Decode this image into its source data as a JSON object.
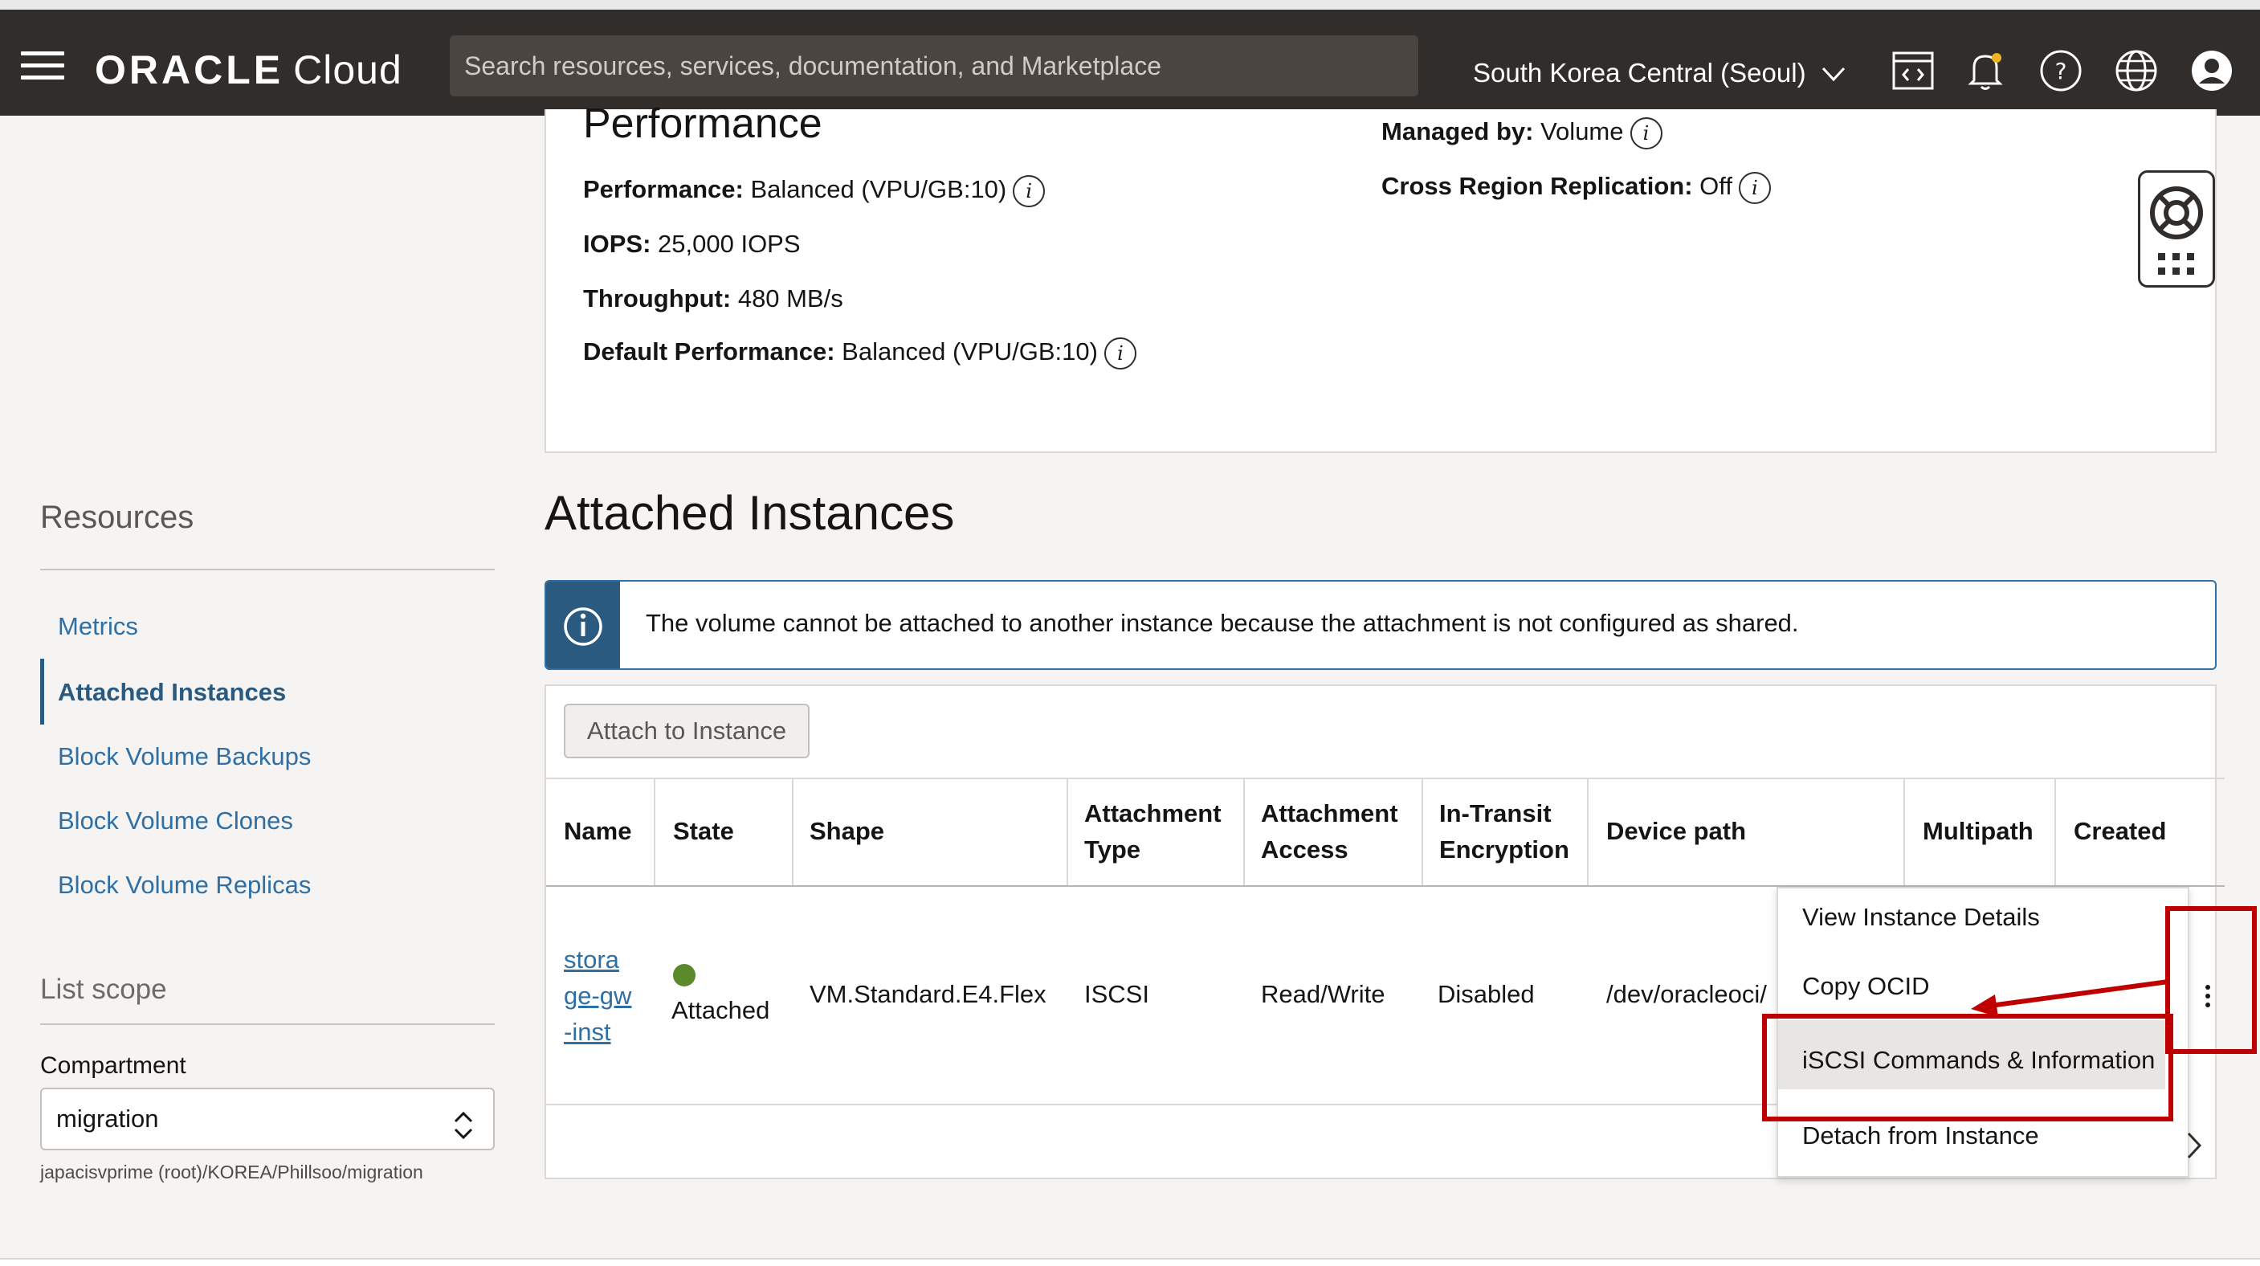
{
  "header": {
    "brand_main": "ORACLE",
    "brand_sub": "Cloud",
    "search_placeholder": "Search resources, services, documentation, and Marketplace",
    "region": "South Korea Central (Seoul)",
    "icons": [
      "menu-icon",
      "code-editor-icon",
      "bell-icon",
      "help-icon",
      "globe-icon",
      "user-icon"
    ]
  },
  "performance": {
    "title": "Performance",
    "rows": [
      {
        "label": "Performance:",
        "value": "Balanced (VPU/GB:10)"
      },
      {
        "label": "IOPS:",
        "value": "25,000 IOPS"
      },
      {
        "label": "Throughput:",
        "value": "480 MB/s"
      },
      {
        "label": "Default Performance:",
        "value": "Balanced (VPU/GB:10)"
      }
    ],
    "right_rows": [
      {
        "label": "Managed by:",
        "value": "Volume"
      },
      {
        "label": "Cross Region Replication:",
        "value": "Off"
      }
    ]
  },
  "sidebar": {
    "resources_title": "Resources",
    "items": [
      {
        "label": "Metrics"
      },
      {
        "label": "Attached Instances"
      },
      {
        "label": "Block Volume Backups"
      },
      {
        "label": "Block Volume Clones"
      },
      {
        "label": "Block Volume Replicas"
      }
    ],
    "list_scope": "List scope",
    "compartment_label": "Compartment",
    "compartment_value": "migration",
    "compartment_path": "japacisvprime (root)/KOREA/Phillsoo/migration"
  },
  "attached": {
    "title": "Attached Instances",
    "banner": "The volume cannot be attached to another instance because the attachment is not configured as shared.",
    "attach_button": "Attach to Instance",
    "columns": [
      {
        "line1": "",
        "line2": "Name"
      },
      {
        "line1": "",
        "line2": "State"
      },
      {
        "line1": "",
        "line2": "Shape"
      },
      {
        "line1": "Attachment",
        "line2": "Type"
      },
      {
        "line1": "Attachment",
        "line2": "Access"
      },
      {
        "line1": "In-Transit",
        "line2": "Encryption"
      },
      {
        "line1": "",
        "line2": "Device path"
      },
      {
        "line1": "",
        "line2": "Multipath"
      },
      {
        "line1": "",
        "line2": "Created"
      }
    ],
    "row": {
      "name_lines": [
        "stora",
        "ge-gw",
        "-inst"
      ],
      "state": "Attached",
      "shape": "VM.Standard.E4.Flex",
      "type": "ISCSI",
      "access": "Read/Write",
      "encryption": "Disabled",
      "device_path": "/dev/oracleoci/"
    },
    "menu": [
      {
        "label": "View Instance Details"
      },
      {
        "label": "Copy OCID"
      },
      {
        "label": "iSCSI Commands & Information"
      },
      {
        "label": "Detach from Instance"
      }
    ]
  },
  "colors": {
    "header_bg": "#312d2a",
    "link": "#2f6fa3",
    "info_bar": "#2b5a80",
    "status_green": "#5b8a2c",
    "annotation_red": "#c00000"
  }
}
